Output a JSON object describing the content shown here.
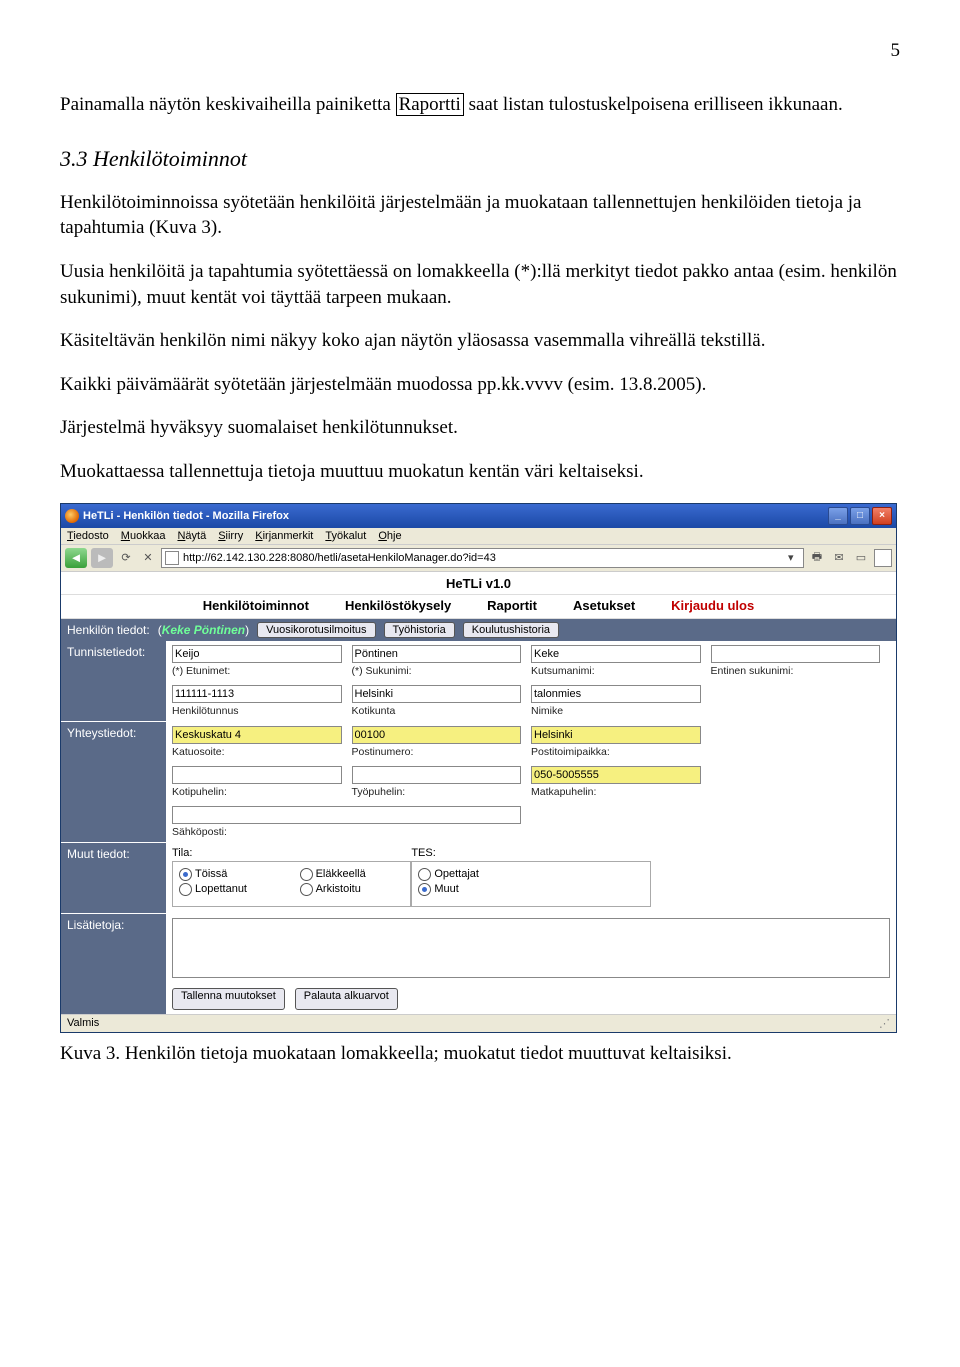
{
  "page_number": "5",
  "para1_a": "Painamalla näytön keskivaiheilla painiketta ",
  "para1_boxed": "Raportti",
  "para1_b": " saat listan tulostuskelpoisena erilliseen ikkunaan.",
  "heading": "3.3 Henkilötoiminnot",
  "para2": "Henkilötoiminnoissa syötetään henkilöitä järjestelmään ja muokataan tallennettujen henkilöiden tietoja ja tapahtumia (Kuva 3).",
  "para3": "Uusia henkilöitä ja tapahtumia syötettäessä on lomakkeella (*):llä merkityt tiedot pakko antaa (esim. henkilön sukunimi), muut kentät voi täyttää tarpeen mukaan.",
  "para4": "Käsiteltävän henkilön nimi näkyy koko ajan näytön yläosassa vasemmalla vihreällä tekstillä.",
  "para5": "Kaikki päivämäärät syötetään järjestelmään muodossa pp.kk.vvvv (esim. 13.8.2005).",
  "para6": "Järjestelmä hyväksyy suomalaiset henkilötunnukset.",
  "para7": "Muokattaessa tallennettuja tietoja muuttuu muokatun kentän väri keltaiseksi.",
  "caption": "Kuva 3. Henkilön tietoja muokataan lomakkeella; muokatut tiedot muuttuvat keltaisiksi.",
  "window": {
    "title": "HeTLi - Henkilön tiedot - Mozilla Firefox",
    "menu": [
      "Tiedosto",
      "Muokkaa",
      "Näytä",
      "Siirry",
      "Kirjanmerkit",
      "Työkalut",
      "Ohje"
    ],
    "url": "http://62.142.130.228:8080/hetli/asetaHenkiloManager.do?id=43",
    "app_title": "HeTLi v1.0",
    "nav": [
      "Henkilötoiminnot",
      "Henkilöstökysely",
      "Raportit",
      "Asetukset"
    ],
    "nav_logout": "Kirjaudu ulos",
    "section_label": "Henkilön tiedot:",
    "person_name": "Keke Pöntinen",
    "section_buttons": [
      "Vuosikorotusilmoitus",
      "Työhistoria",
      "Koulutushistoria"
    ],
    "rows": {
      "tunniste": {
        "label": "Tunnistetiedot:",
        "line1": [
          {
            "val": "Keijo",
            "lbl": "(*) Etunimet:"
          },
          {
            "val": "Pöntinen",
            "lbl": "(*) Sukunimi:"
          },
          {
            "val": "Keke",
            "lbl": "Kutsumanimi:"
          },
          {
            "val": "",
            "lbl": "Entinen sukunimi:"
          }
        ],
        "line2": [
          {
            "val": "111111-1113",
            "lbl": "Henkilötunnus"
          },
          {
            "val": "Helsinki",
            "lbl": "Kotikunta"
          },
          {
            "val": "talonmies",
            "lbl": "Nimike"
          },
          {
            "val": "",
            "lbl": ""
          }
        ]
      },
      "yhteys": {
        "label": "Yhteystiedot:",
        "line1": [
          {
            "val": "Keskuskatu 4",
            "lbl": "Katuosoite:",
            "hl": true
          },
          {
            "val": "00100",
            "lbl": "Postinumero:",
            "hl": true
          },
          {
            "val": "Helsinki",
            "lbl": "Postitoimipaikka:",
            "hl": true
          },
          {
            "val": "",
            "lbl": ""
          }
        ],
        "line2": [
          {
            "val": "",
            "lbl": "Kotipuhelin:"
          },
          {
            "val": "",
            "lbl": "Työpuhelin:"
          },
          {
            "val": "050-5005555",
            "lbl": "Matkapuhelin:",
            "hl": true
          },
          {
            "val": "",
            "lbl": ""
          }
        ],
        "line3": [
          {
            "val": "",
            "lbl": "Sähköposti:"
          }
        ]
      },
      "muut": {
        "label": "Muut tiedot:",
        "tila_label": "Tila:",
        "tila": [
          {
            "t": "Töissä",
            "s": true
          },
          {
            "t": "Eläkkeellä",
            "s": false
          },
          {
            "t": "Lopettanut",
            "s": false
          },
          {
            "t": "Arkistoitu",
            "s": false
          }
        ],
        "tes_label": "TES:",
        "tes": [
          {
            "t": "Opettajat",
            "s": false
          },
          {
            "t": "Muut",
            "s": true
          }
        ]
      },
      "lisa": {
        "label": "Lisätietoja:"
      }
    },
    "actions": [
      "Tallenna muutokset",
      "Palauta alkuarvot"
    ],
    "status": "Valmis"
  }
}
